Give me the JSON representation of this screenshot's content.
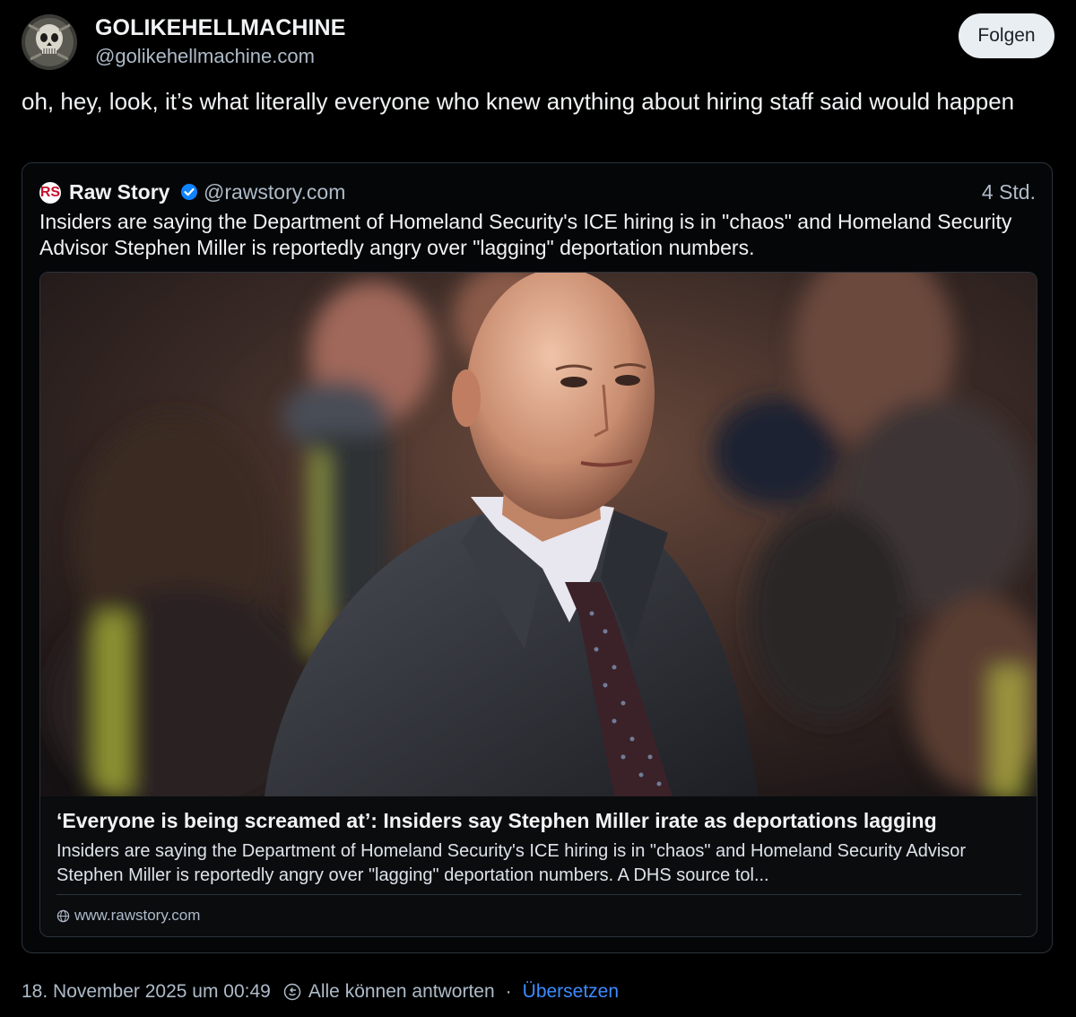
{
  "author": {
    "display_name": "GOLIKEHELLMACHINE",
    "handle": "@golikehellmachine.com",
    "avatar_icon": "skull-avatar"
  },
  "follow_button": {
    "label": "Folgen"
  },
  "post": {
    "text": "oh, hey, look, it’s what literally everyone who knew anything about hiring staff said would happen"
  },
  "quote": {
    "logo_text": "RS",
    "author_name": "Raw Story",
    "verified_icon": "verified-check-icon",
    "handle": "@rawstory.com",
    "time": "4 Std.",
    "text": "Insiders are saying the Department of Homeland Security's ICE hiring is in \"chaos\" and Homeland Security Advisor Stephen Miller is reportedly angry over \"lagging\" deportation numbers.",
    "link_card": {
      "title": "‘Everyone is being screamed at’: Insiders say Stephen Miller irate as deportations lagging",
      "description": "Insiders are saying the Department of Homeland Security's ICE hiring is in \"chaos\" and Homeland Security Advisor Stephen Miller is reportedly angry over \"lagging\" deportation numbers. A DHS source tol...",
      "domain": "www.rawstory.com",
      "domain_icon": "globe-icon"
    }
  },
  "footer": {
    "timestamp": "18. November 2025 um 00:49",
    "reply_icon": "reply-settings-icon",
    "reply_setting": "Alle können antworten",
    "separator": "·",
    "translate_label": "Übersetzen"
  },
  "colors": {
    "background": "#000000",
    "text_primary": "#f1f3f5",
    "text_secondary": "#aebbc9",
    "link_blue": "#3d8bff",
    "verified_blue": "#1083fe",
    "border": "#2b333d"
  }
}
